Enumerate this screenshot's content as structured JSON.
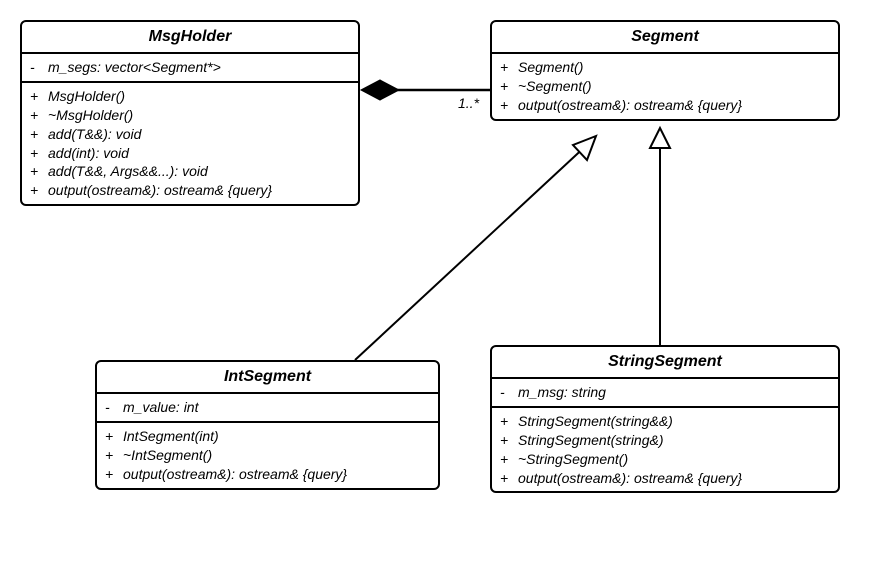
{
  "classes": {
    "msgholder": {
      "name": "MsgHolder",
      "attributes": [
        {
          "vis": "-",
          "text": "m_segs: vector<Segment*>"
        }
      ],
      "operations": [
        {
          "vis": "+",
          "text": "MsgHolder()"
        },
        {
          "vis": "+",
          "text": "~MsgHolder()"
        },
        {
          "vis": "+",
          "text": "add(T&&): void"
        },
        {
          "vis": "+",
          "text": "add(int): void"
        },
        {
          "vis": "+",
          "text": "add(T&&, Args&&...): void"
        },
        {
          "vis": "+",
          "text": "output(ostream&): ostream& {query}"
        }
      ]
    },
    "segment": {
      "name": "Segment",
      "operations": [
        {
          "vis": "+",
          "text": "Segment()"
        },
        {
          "vis": "+",
          "text": "~Segment()"
        },
        {
          "vis": "+",
          "text": "output(ostream&): ostream& {query}"
        }
      ]
    },
    "intsegment": {
      "name": "IntSegment",
      "attributes": [
        {
          "vis": "-",
          "text": "m_value: int"
        }
      ],
      "operations": [
        {
          "vis": "+",
          "text": "IntSegment(int)"
        },
        {
          "vis": "+",
          "text": "~IntSegment()"
        },
        {
          "vis": "+",
          "text": "output(ostream&): ostream& {query}"
        }
      ]
    },
    "stringsegment": {
      "name": "StringSegment",
      "attributes": [
        {
          "vis": "-",
          "text": "m_msg: string"
        }
      ],
      "operations": [
        {
          "vis": "+",
          "text": "StringSegment(string&&)"
        },
        {
          "vis": "+",
          "text": "StringSegment(string&)"
        },
        {
          "vis": "+",
          "text": "~StringSegment()"
        },
        {
          "vis": "+",
          "text": "output(ostream&): ostream& {query}"
        }
      ]
    }
  },
  "relations": {
    "composition": {
      "from": "msgholder",
      "to": "segment",
      "multiplicity": "1..*"
    },
    "inheritance": [
      {
        "child": "intsegment",
        "parent": "segment"
      },
      {
        "child": "stringsegment",
        "parent": "segment"
      }
    ]
  }
}
